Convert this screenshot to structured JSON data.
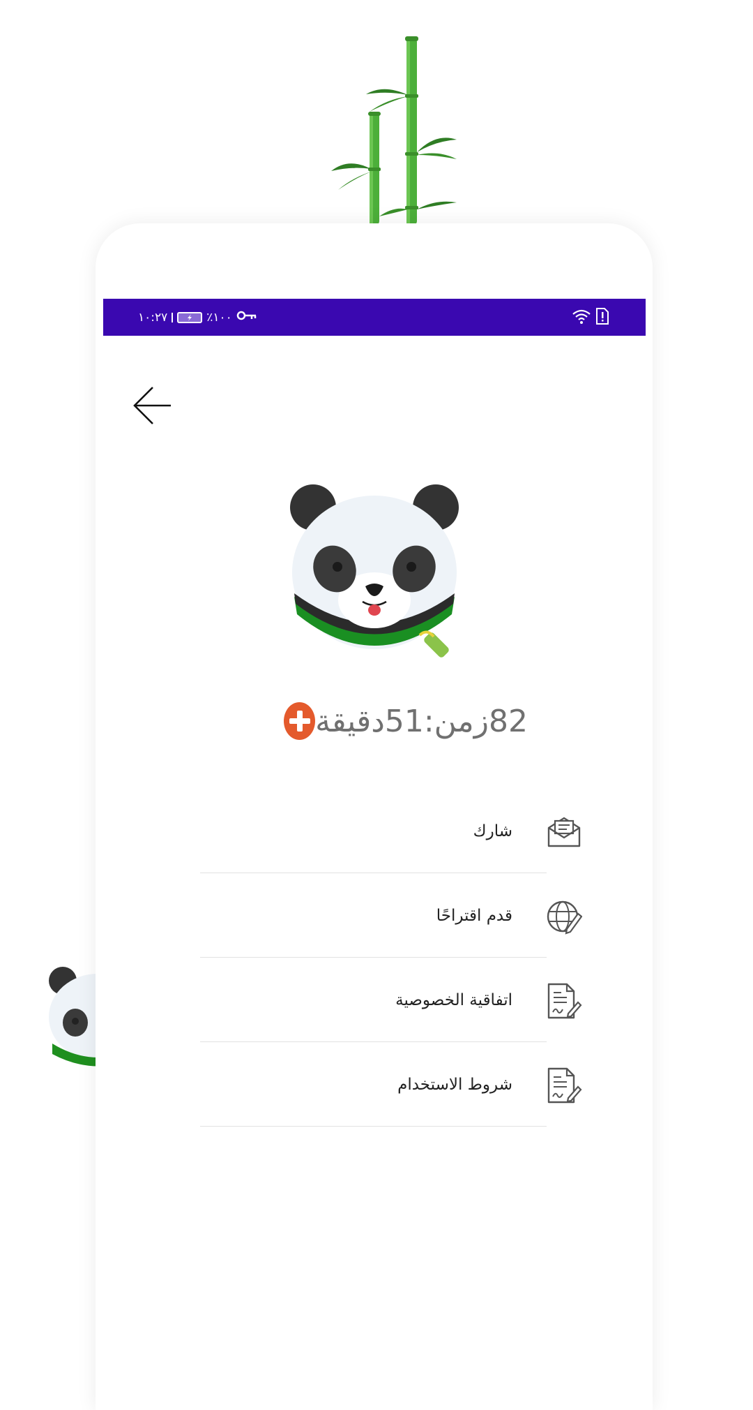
{
  "status_bar": {
    "time": "١٠:٢٧",
    "battery_percent": "٪١٠٠",
    "icons": [
      "vpn-key-icon",
      "battery-icon",
      "wifi-icon",
      "sim-alert-icon"
    ]
  },
  "header": {
    "back_icon": "arrow-left-icon"
  },
  "balance": {
    "text": "82زمن:51دقيقة",
    "add_icon": "plus-icon",
    "add_color": "#e45a2c"
  },
  "menu": {
    "items": [
      {
        "label": "شارك",
        "icon": "envelope-icon"
      },
      {
        "label": "قدم اقتراحًا",
        "icon": "globe-pencil-icon"
      },
      {
        "label": "اتفاقية الخصوصية",
        "icon": "document-sign-icon"
      },
      {
        "label": "شروط الاستخدام",
        "icon": "document-sign-icon"
      }
    ]
  },
  "colors": {
    "status_bar": "#3a08b0",
    "bamboo": "#4caf3a",
    "accent": "#e45a2c"
  }
}
